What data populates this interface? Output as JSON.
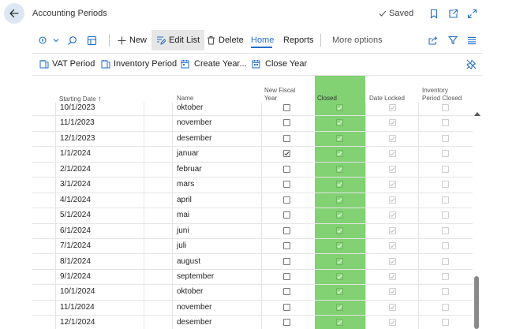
{
  "window": {
    "title": "Accounting Periods",
    "status": "Saved"
  },
  "icons": {
    "back": "back-arrow-icon",
    "bookmark": "bookmark-icon",
    "popout": "open-in-new-window-icon",
    "expand": "expand-icon",
    "filter": "filter-icon",
    "list": "list-view-icon",
    "share": "share-icon"
  },
  "commands": {
    "new": "New",
    "edit_list": "Edit List",
    "delete": "Delete",
    "home": "Home",
    "reports": "Reports",
    "more_options": "More options"
  },
  "actions": {
    "vat_period": "VAT Period",
    "inventory_period": "Inventory Period",
    "create_year": "Create Year...",
    "close_year": "Close Year"
  },
  "columns": {
    "starting_date": "Starting Date",
    "sort_arrow": "↑",
    "name": "Name",
    "new_fiscal_year": [
      "New Fiscal",
      "Year"
    ],
    "closed": "Closed",
    "date_locked": "Date Locked",
    "inventory_period_closed": [
      "Inventory",
      "Period Closed"
    ]
  },
  "rows": [
    {
      "date": "10/1/2023",
      "name": "oktober",
      "new_fiscal_year": false,
      "closed": true,
      "date_locked": true,
      "inventory_closed": false
    },
    {
      "date": "11/1/2023",
      "name": "november",
      "new_fiscal_year": false,
      "closed": true,
      "date_locked": true,
      "inventory_closed": false
    },
    {
      "date": "12/1/2023",
      "name": "desember",
      "new_fiscal_year": false,
      "closed": true,
      "date_locked": true,
      "inventory_closed": false
    },
    {
      "date": "1/1/2024",
      "name": "januar",
      "new_fiscal_year": true,
      "closed": true,
      "date_locked": true,
      "inventory_closed": false
    },
    {
      "date": "2/1/2024",
      "name": "februar",
      "new_fiscal_year": false,
      "closed": true,
      "date_locked": true,
      "inventory_closed": false
    },
    {
      "date": "3/1/2024",
      "name": "mars",
      "new_fiscal_year": false,
      "closed": true,
      "date_locked": true,
      "inventory_closed": false
    },
    {
      "date": "4/1/2024",
      "name": "april",
      "new_fiscal_year": false,
      "closed": true,
      "date_locked": true,
      "inventory_closed": false
    },
    {
      "date": "5/1/2024",
      "name": "mai",
      "new_fiscal_year": false,
      "closed": true,
      "date_locked": true,
      "inventory_closed": false
    },
    {
      "date": "6/1/2024",
      "name": "juni",
      "new_fiscal_year": false,
      "closed": true,
      "date_locked": true,
      "inventory_closed": false
    },
    {
      "date": "7/1/2024",
      "name": "juli",
      "new_fiscal_year": false,
      "closed": true,
      "date_locked": true,
      "inventory_closed": false
    },
    {
      "date": "8/1/2024",
      "name": "august",
      "new_fiscal_year": false,
      "closed": true,
      "date_locked": true,
      "inventory_closed": false
    },
    {
      "date": "9/1/2024",
      "name": "september",
      "new_fiscal_year": false,
      "closed": true,
      "date_locked": true,
      "inventory_closed": false
    },
    {
      "date": "10/1/2024",
      "name": "oktober",
      "new_fiscal_year": false,
      "closed": true,
      "date_locked": true,
      "inventory_closed": false
    },
    {
      "date": "11/1/2024",
      "name": "november",
      "new_fiscal_year": false,
      "closed": true,
      "date_locked": true,
      "inventory_closed": false
    },
    {
      "date": "12/1/2024",
      "name": "desember",
      "new_fiscal_year": false,
      "closed": true,
      "date_locked": true,
      "inventory_closed": false
    }
  ],
  "colors": {
    "accent": "#1f6dc9",
    "closed_column": "#82d173",
    "back_button_bg": "#dde7f3"
  }
}
